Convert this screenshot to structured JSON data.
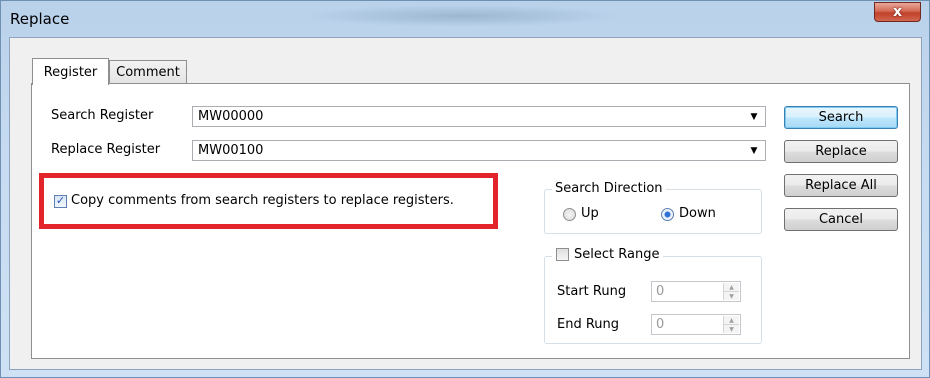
{
  "window": {
    "title": "Replace",
    "close_glyph": "x"
  },
  "tabs": [
    {
      "label": "Register",
      "active": true
    },
    {
      "label": "Comment",
      "active": false
    }
  ],
  "form": {
    "search_register": {
      "label": "Search Register",
      "value": "MW00000"
    },
    "replace_register": {
      "label": "Replace Register",
      "value": "MW00100"
    }
  },
  "buttons": {
    "search": "Search",
    "replace": "Replace",
    "replace_all": "Replace All",
    "cancel": "Cancel"
  },
  "copy_comments": {
    "label": "Copy comments from search registers to replace registers.",
    "checked": true
  },
  "search_direction": {
    "title": "Search Direction",
    "options": [
      {
        "label": "Up",
        "selected": false
      },
      {
        "label": "Down",
        "selected": true
      }
    ]
  },
  "select_range": {
    "title": "Select Range",
    "checked": false,
    "start_rung": {
      "label": "Start Rung",
      "value": "0"
    },
    "end_rung": {
      "label": "End Rung",
      "value": "0"
    }
  },
  "colors": {
    "highlight": "#e3242b",
    "title_bar": "#c6dbf1",
    "close_button": "#c2402a"
  }
}
